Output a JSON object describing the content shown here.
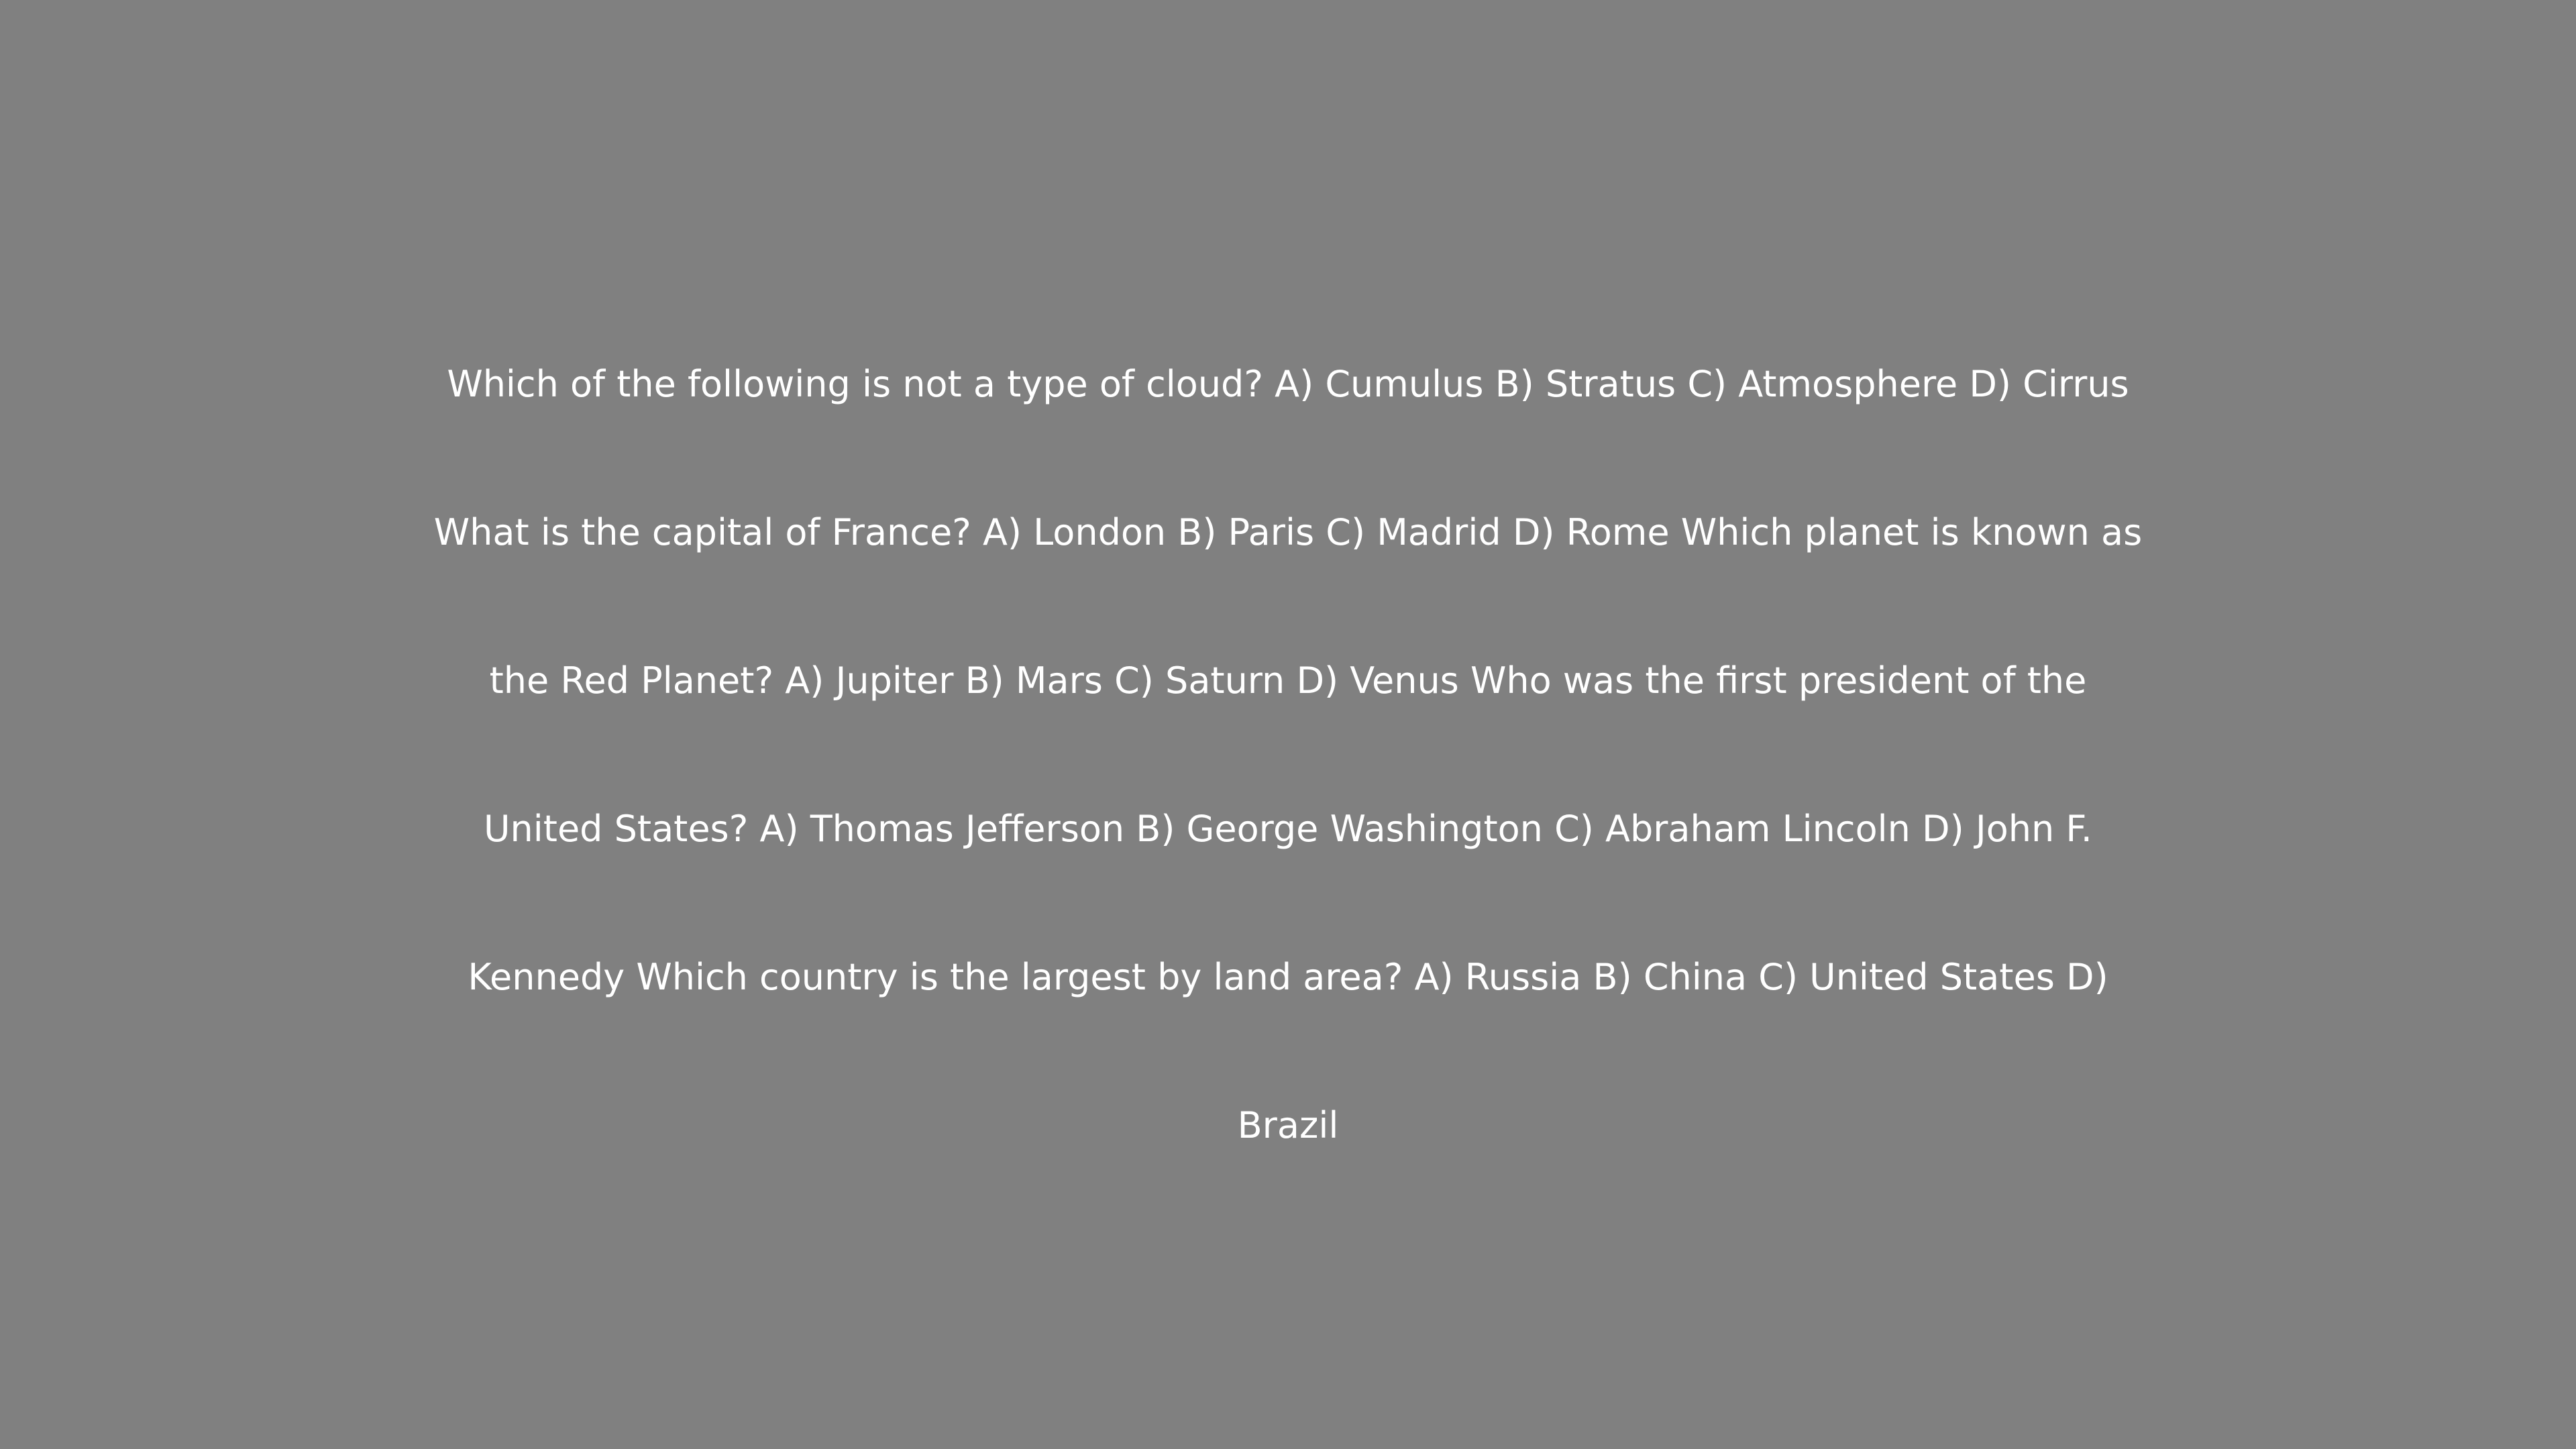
{
  "colors": {
    "background": "#808080",
    "text": "#ffffff"
  },
  "quiz": {
    "lines": [
      "Which of the following is not a type of cloud? A) Cumulus B) Stratus C) Atmosphere D) Cirrus",
      "What is the capital of France? A) London B) Paris C) Madrid D) Rome Which planet is known as",
      "the Red Planet? A) Jupiter B) Mars C) Saturn D) Venus Who was the first president of the",
      "United States? A) Thomas Jefferson B) George Washington C) Abraham Lincoln D) John F.",
      "Kennedy Which country is the largest by land area? A) Russia B) China C) United States D)",
      "Brazil"
    ]
  }
}
